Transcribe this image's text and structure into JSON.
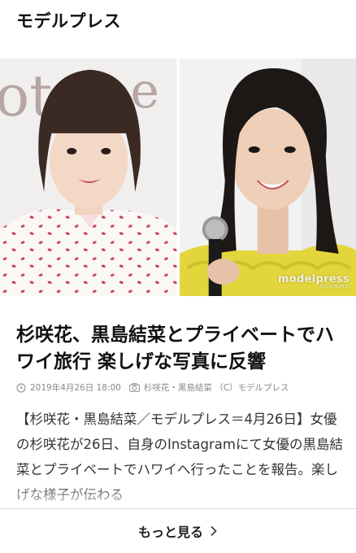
{
  "header": {
    "brand": "モデルプレス"
  },
  "hero": {
    "left_alt": "杉咲花",
    "right_alt": "黒島結菜",
    "watermark": "modelpress",
    "watermark_sub": "OCONING"
  },
  "article": {
    "headline": "杉咲花、黒島結菜とプライベートでハワイ旅行 楽しげな写真に反響",
    "date": "2019年4月26日 18:00",
    "credit": "杉咲花・黒島結菜 （C）モデルプレス",
    "body": "【杉咲花・黒島結菜／モデルプレス＝4月26日】女優の杉咲花が26日、自身のInstagramにて女優の黒島結菜とプライベートでハワイへ行ったことを報告。楽しげな様子が伝わる"
  },
  "more": {
    "label": "もっと見る"
  },
  "icons": {
    "clock": "clock-icon",
    "camera": "camera-icon",
    "chevron": "chevron-right-icon"
  }
}
